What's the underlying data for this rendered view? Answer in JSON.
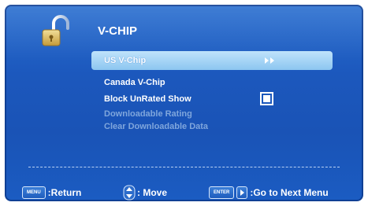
{
  "header": {
    "title": "V-CHIP",
    "icon": "open-padlock-icon"
  },
  "menu": {
    "items": [
      {
        "label": "US V-Chip",
        "state": "selected",
        "indicator": "double-arrow-icon"
      },
      {
        "label": "Canada V-Chip",
        "state": "normal"
      },
      {
        "label": "Block UnRated Show",
        "state": "normal",
        "checkbox": true
      },
      {
        "label": "Downloadable Rating",
        "state": "disabled"
      },
      {
        "label": "Clear Downloadable Data",
        "state": "disabled"
      }
    ]
  },
  "footer": {
    "menu_key": "MENU",
    "return_label": ":Return",
    "move_label": ": Move",
    "enter_key": "ENTER",
    "next_label": ":Go to Next Menu"
  },
  "colors": {
    "background": "#1c58bd",
    "highlight": "#9fd1f4",
    "disabled_text": "#7fa6dc",
    "text": "#ffffff"
  }
}
